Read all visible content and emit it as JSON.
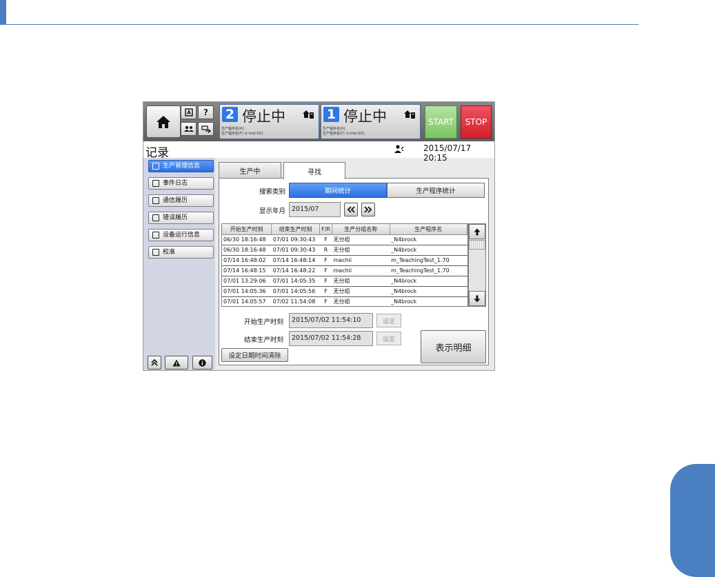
{
  "topbar": {
    "panel2": {
      "num": "2",
      "status": "停止中",
      "sub1": "生产程序名(R)：",
      "sub2": "生产程序名(F) :k-trial-001"
    },
    "panel1": {
      "num": "1",
      "status": "停止中",
      "sub1": "生产程序名(R)：",
      "sub2": "生产程序名(F) :k-trial-001"
    },
    "start_label": "START",
    "stop_label": "STOP",
    "help_label": "?"
  },
  "titlebar": {
    "title": "记录",
    "datetime": "2015/07/17 20:15"
  },
  "sidebar": {
    "items": [
      {
        "label": "生产管理信息",
        "active": true
      },
      {
        "label": "事件日志"
      },
      {
        "label": "通信履历"
      },
      {
        "label": "错误履历"
      },
      {
        "label": "设备运行信息"
      },
      {
        "label": "校准"
      }
    ]
  },
  "tabs": [
    {
      "label": "生产中"
    },
    {
      "label": "寻找",
      "active": true
    }
  ],
  "search": {
    "type_label": "搜索类别",
    "type_options": [
      "期间统计",
      "生产程序统计"
    ],
    "selected_type": "期间统计",
    "month_label": "显示年月",
    "month_value": "2015/07"
  },
  "table": {
    "headers": [
      "开始生产时刻",
      "结束生产时刻",
      "F/R",
      "生产分组名称",
      "生产程序名"
    ],
    "rows": [
      [
        "06/30 18:16:48",
        "07/01 09:30:43",
        "F",
        "无分组",
        "_N4brock"
      ],
      [
        "06/30 18:16:48",
        "07/01 09:30:43",
        "R",
        "无分组",
        "_N4brock"
      ],
      [
        "07/14 16:48:02",
        "07/14 16:48:14",
        "F",
        "machii",
        "m_TeachingTest_1.70"
      ],
      [
        "07/14 16:48:15",
        "07/14 16:48:22",
        "F",
        "machii",
        "m_TeachingTest_1.70"
      ],
      [
        "07/01 13:29:06",
        "07/01 14:05:35",
        "F",
        "无分组",
        "_N4brock"
      ],
      [
        "07/01 14:05:36",
        "07/01 14:05:56",
        "F",
        "无分组",
        "_N4brock"
      ],
      [
        "07/01 14:05:57",
        "07/02 11:54:08",
        "F",
        "无分组",
        "_N4brock"
      ]
    ]
  },
  "times": {
    "start_label": "开始生产时刻",
    "start_value": "2015/07/02 11:54:10",
    "end_label": "结束生产时刻",
    "end_value": "2015/07/02 11:54:28",
    "set_label": "设定"
  },
  "buttons": {
    "clear_label": "设定日期时间清除",
    "detail_label": "表示明细"
  }
}
